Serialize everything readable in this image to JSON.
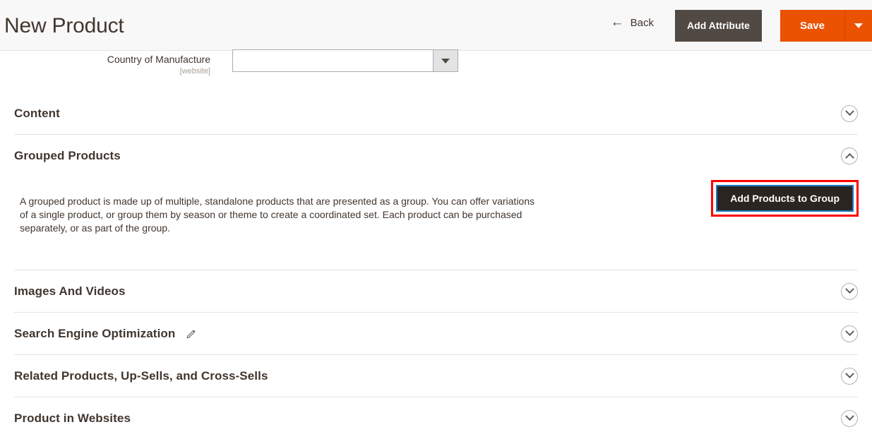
{
  "header": {
    "title": "New Product",
    "back_label": "Back",
    "back_icon": "arrow-left-icon",
    "add_attribute_label": "Add Attribute",
    "save_label": "Save",
    "save_toggle_icon": "caret-down-icon",
    "save_color": "#eb5202",
    "add_attribute_color": "#514943"
  },
  "field": {
    "label": "Country of Manufacture",
    "scope": "[website]",
    "value": "",
    "dropdown_icon": "caret-down-icon"
  },
  "sections": [
    {
      "title": "Content",
      "toggle_icon": "chevron-down-icon",
      "expanded": false,
      "has_edit_pencil": false
    },
    {
      "title": "Grouped Products",
      "toggle_icon": "chevron-up-icon",
      "expanded": true,
      "has_edit_pencil": false
    },
    {
      "title": "Images And Videos",
      "toggle_icon": "chevron-down-icon",
      "expanded": false,
      "has_edit_pencil": false
    },
    {
      "title": "Search Engine Optimization",
      "toggle_icon": "chevron-down-icon",
      "expanded": false,
      "has_edit_pencil": true,
      "edit_icon": "pencil-icon"
    },
    {
      "title": "Related Products, Up-Sells, and Cross-Sells",
      "toggle_icon": "chevron-down-icon",
      "expanded": false,
      "has_edit_pencil": false
    },
    {
      "title": "Product in Websites",
      "toggle_icon": "chevron-down-icon",
      "expanded": false,
      "has_edit_pencil": false
    }
  ],
  "grouped_products": {
    "description": "A grouped product is made up of multiple, standalone products that are presented as a group. You can offer variations of a single product, or group them by season or theme to create a coordinated set. Each product can be purchased separately, or as part of the group.",
    "add_button_label": "Add Products to Group",
    "highlight_color": "#ff0000",
    "focus_ring_color": "#1979c3",
    "button_color": "#2b2521"
  }
}
